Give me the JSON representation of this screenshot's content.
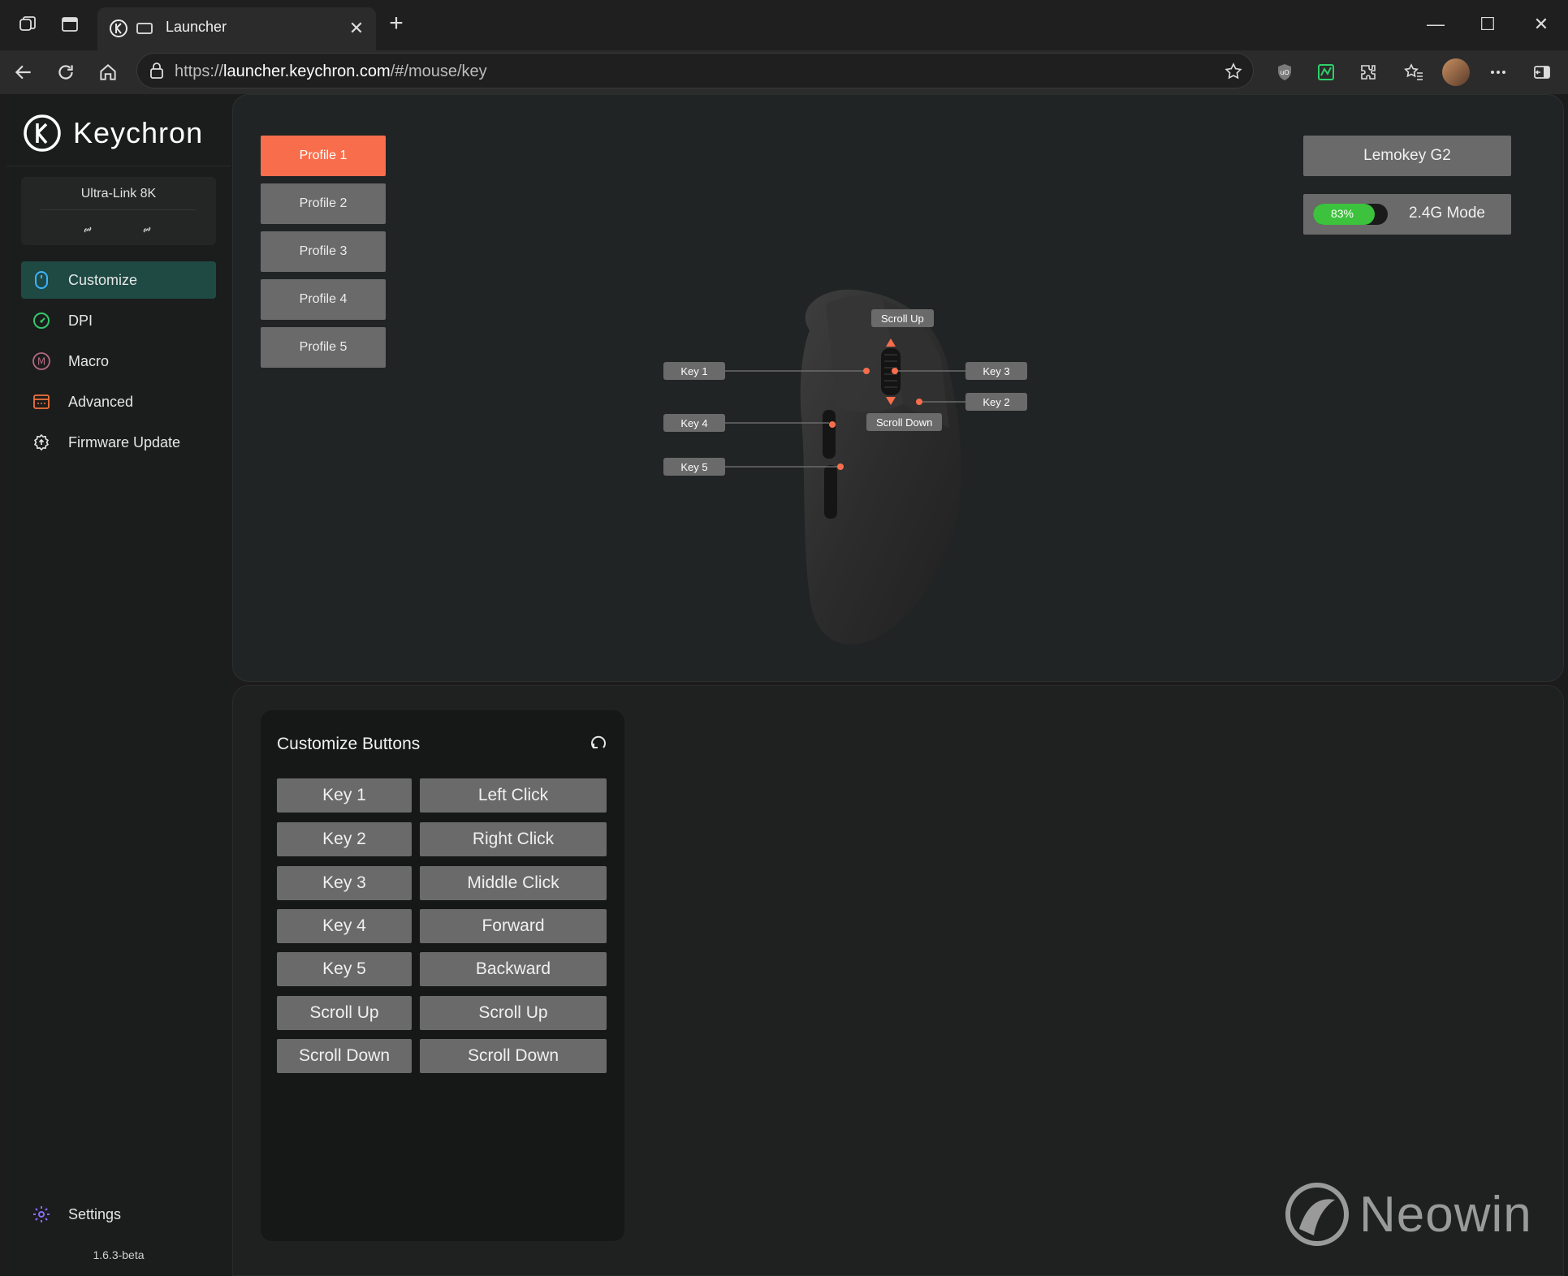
{
  "browser": {
    "tab_title": "Launcher",
    "url_prefix": "https://",
    "url_host": "launcher.keychron.com",
    "url_path": "/#/mouse/key"
  },
  "sidebar": {
    "brand": "Keychron",
    "device": "Ultra-Link 8K",
    "items": [
      {
        "label": "Customize",
        "icon": "mouse-icon",
        "active": true
      },
      {
        "label": "DPI",
        "icon": "gauge-icon"
      },
      {
        "label": "Macro",
        "icon": "macro-m-icon"
      },
      {
        "label": "Advanced",
        "icon": "advanced-window-icon"
      },
      {
        "label": "Firmware Update",
        "icon": "firmware-update-icon"
      }
    ],
    "settings_label": "Settings",
    "version": "1.6.3-beta"
  },
  "profiles": [
    "Profile 1",
    "Profile 2",
    "Profile 3",
    "Profile 4",
    "Profile 5"
  ],
  "device_panel": {
    "model": "Lemokey G2",
    "battery": "83%",
    "battery_level": 0.83,
    "mode": "2.4G Mode"
  },
  "mouse_callouts": {
    "scroll_up": "Scroll Up",
    "key1": "Key 1",
    "key3": "Key 3",
    "key2": "Key 2",
    "scroll_down": "Scroll Down",
    "key4": "Key 4",
    "key5": "Key 5"
  },
  "customize": {
    "title": "Customize Buttons",
    "rows": [
      {
        "key": "Key 1",
        "action": "Left Click"
      },
      {
        "key": "Key 2",
        "action": "Right Click"
      },
      {
        "key": "Key 3",
        "action": "Middle Click"
      },
      {
        "key": "Key 4",
        "action": "Forward"
      },
      {
        "key": "Key 5",
        "action": "Backward"
      },
      {
        "key": "Scroll Up",
        "action": "Scroll Up"
      },
      {
        "key": "Scroll Down",
        "action": "Scroll Down"
      }
    ]
  },
  "watermark": "Neowin",
  "colors": {
    "accent": "#f86e4c",
    "active_nav": "#1f4a44",
    "battery": "#3cc23c",
    "button": "#6a6a6a"
  }
}
